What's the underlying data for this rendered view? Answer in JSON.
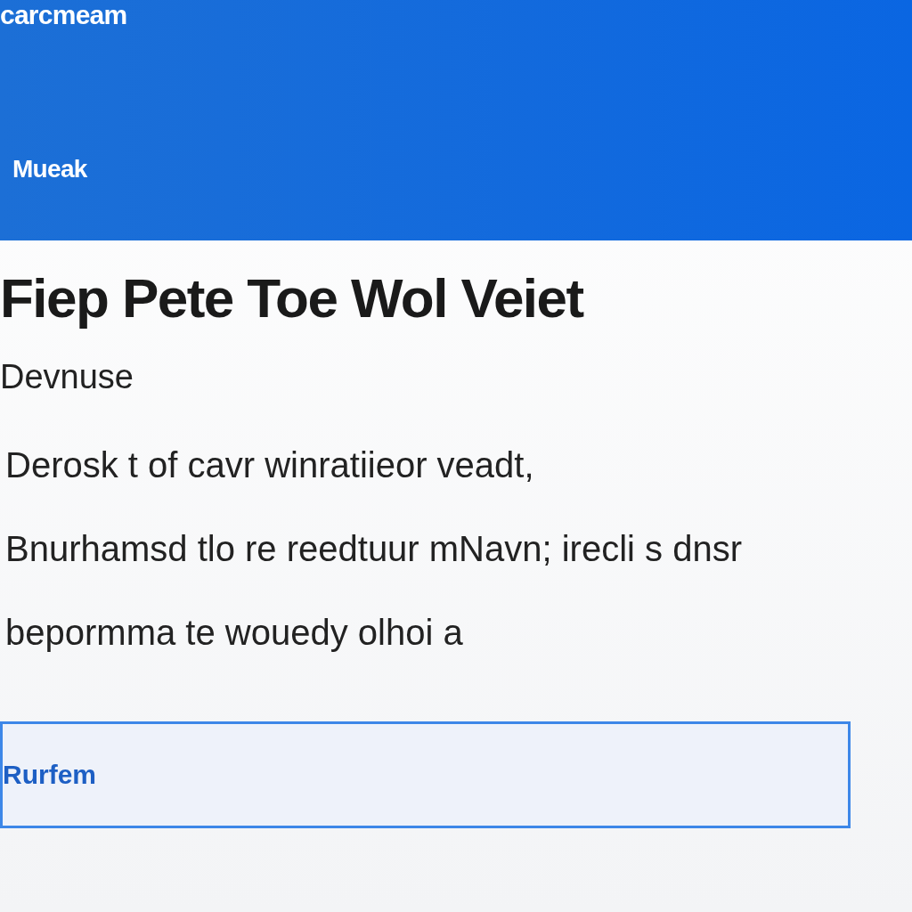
{
  "header": {
    "brand": "carcmeam",
    "subtitle": "Mueak"
  },
  "content": {
    "title": "Fiep Pete Toe Wol Veiet",
    "subheading": "Devnuse",
    "paragraph_lines": [
      "Derosk t of cavr winratiieor veadt,",
      "Bnurhamsd tlo re reedtuur mNavn; irecli s dnsr",
      "bepormma te wouedy olhoi a"
    ]
  },
  "field": {
    "value": "Rurfem"
  }
}
